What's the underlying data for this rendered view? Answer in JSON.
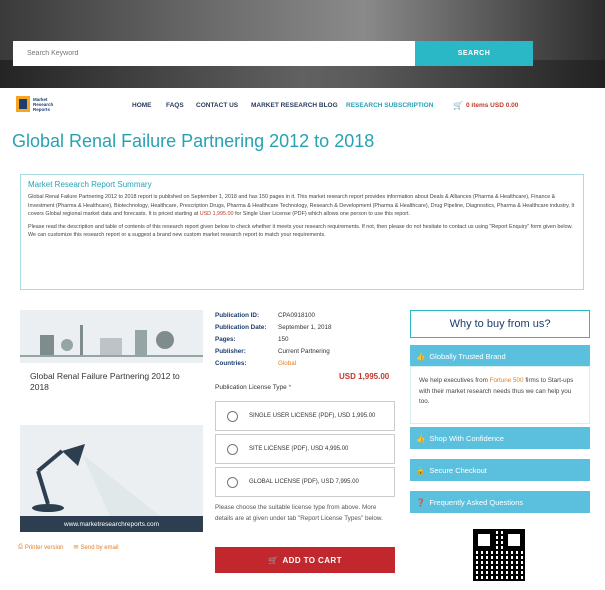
{
  "search": {
    "placeholder": "Search Keyword",
    "button": "SEARCH"
  },
  "logo": {
    "text": "Market Research Reports"
  },
  "nav": {
    "items": [
      "HOME",
      "FAQS",
      "CONTACT US",
      "MARKET RESEARCH BLOG",
      "RESEARCH SUBSCRIPTION"
    ],
    "cart": "0 items USD 0.00"
  },
  "page": {
    "title": "Global Renal Failure Partnering 2012 to 2018"
  },
  "summary": {
    "heading": "Market Research Report Summary",
    "p1_a": "Global Renal Failure Partnering 2012 to 2018 report is published on September 1, 2018 and has 150 pages in it. This market research report provides information about Deals & Alliances (Pharma & Healthcare), Finance & Investment (Pharma & Healthcare), Biotechnology, Healthcare, Prescription Drugs, Pharma & Healthcare Technology, Research & Development (Pharma & Healthcare), Drug Pipeline, Diagnostics, Pharma & Healthcare industry. It covers Global regional market data and forecasts. It is priced starting at",
    "p1_price": "USD 1,995.00",
    "p1_b": "for Single User License (PDF) which allows one person to use this report.",
    "p2": "Please read the description and table of contents of this research report given below to check whether it meets your research requirements. If not, then please do not hesitate to contact us using \"Report Enquiry\" form given below. We can customize this research report or a suggest a brand new custom market research report to match your requirements."
  },
  "product": {
    "image_title": "Global Renal Failure Partnering 2012 to 2018",
    "image_url": "www.marketresearchreports.com",
    "printer": "Printer version",
    "email": "Send by email"
  },
  "meta": {
    "id_label": "Publication ID:",
    "id": "CPA0918100",
    "date_label": "Publication Date:",
    "date": "September 1, 2018",
    "pages_label": "Pages:",
    "pages": "150",
    "publisher_label": "Publisher:",
    "publisher": "Current Partnering",
    "countries_label": "Countries:",
    "countries": "Global"
  },
  "price": "USD 1,995.00",
  "license": {
    "label": "Publication License Type",
    "star": "*",
    "options": [
      "SINGLE USER LICENSE (PDF), USD 1,995.00",
      "SITE LICENSE (PDF), USD 4,995.00",
      "GLOBAL LICENSE (PDF), USD 7,995.00"
    ],
    "note": "Please choose the suitable license type from above. More details are at given under tab \"Report License Types\" below.",
    "add_to_cart": "ADD TO CART"
  },
  "why": {
    "title": "Why to buy from us?",
    "trusted": "Globally Trusted Brand",
    "trusted_a": "We help executives from",
    "trusted_hl": "Fortune 500",
    "trusted_b": "firms to Start-ups with their market research needs thus we can help you too.",
    "confidence": "Shop With Confidence",
    "checkout": "Secure Checkout",
    "faq": "Frequently Asked Questions"
  },
  "colors": {
    "accent": "#27a2b3",
    "cart_red": "#c1272d",
    "sidebar_blue": "#5bc0de"
  }
}
